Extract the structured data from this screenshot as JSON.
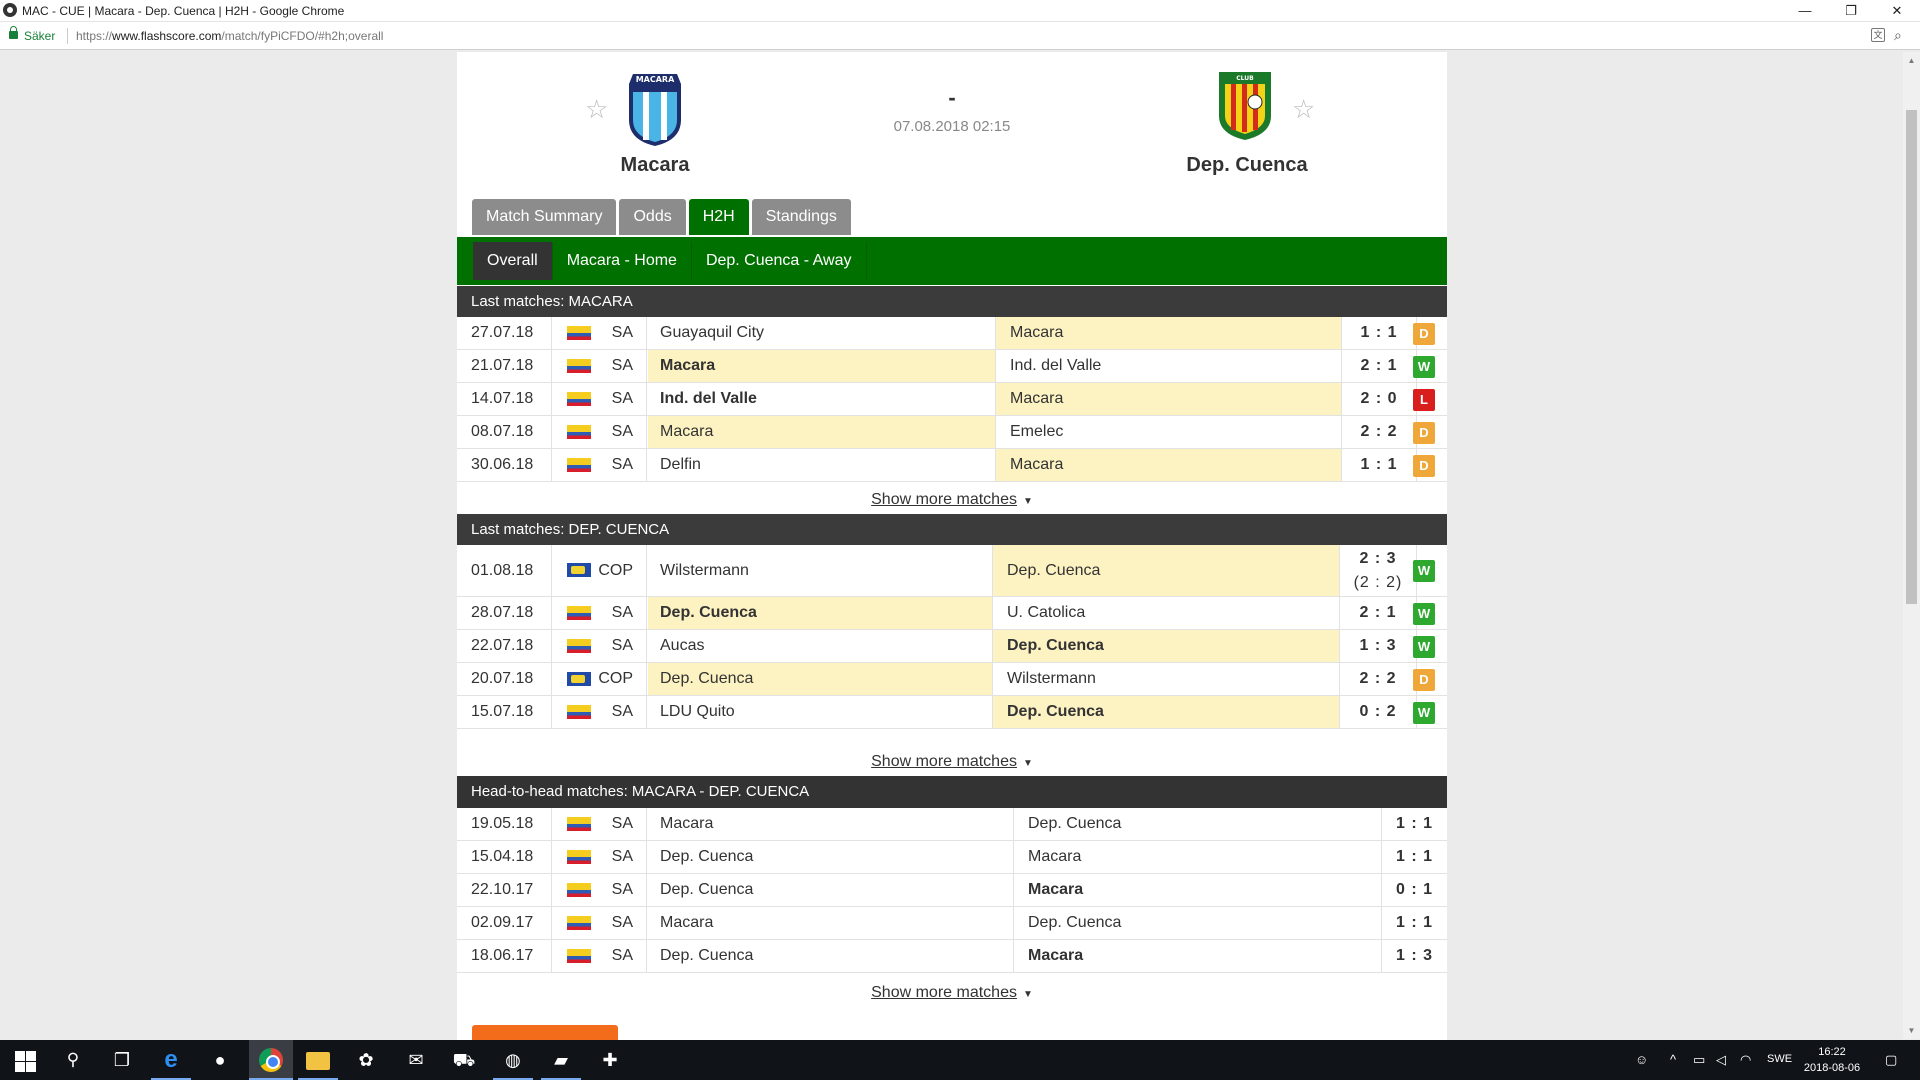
{
  "window": {
    "title": "MAC - CUE | Macara - Dep. Cuenca | H2H - Google Chrome",
    "minimize": "—",
    "maximize": "❐",
    "close": "✕"
  },
  "addressbar": {
    "secure_label": "Säker",
    "url_prefix": "https://",
    "url_host": "www.flashscore.com",
    "url_path": "/match/fyPiCFDO/#h2h;overall"
  },
  "match": {
    "home_team": "Macara",
    "away_team": "Dep. Cuenca",
    "score": "-",
    "datetime": "07.08.2018 02:15",
    "home_logo_text": "MACARA",
    "away_logo_text": "CLUB"
  },
  "tabs": [
    "Match Summary",
    "Odds",
    "H2H",
    "Standings"
  ],
  "active_tab": "H2H",
  "subtabs": [
    "Overall",
    "Macara - Home",
    "Dep. Cuenca - Away"
  ],
  "active_subtab": "Overall",
  "sections": {
    "last_home": {
      "title": "Last matches: MACARA",
      "rows": [
        {
          "date": "27.07.18",
          "comp": "SA",
          "flag": "ec",
          "home": "Guayaquil City",
          "away": "Macara",
          "score": "1 : 1",
          "result": "D",
          "hl": "away",
          "bold": ""
        },
        {
          "date": "21.07.18",
          "comp": "SA",
          "flag": "ec",
          "home": "Macara",
          "away": "Ind. del Valle",
          "score": "2 : 1",
          "result": "W",
          "hl": "home",
          "bold": "home"
        },
        {
          "date": "14.07.18",
          "comp": "SA",
          "flag": "ec",
          "home": "Ind. del Valle",
          "away": "Macara",
          "score": "2 : 0",
          "result": "L",
          "hl": "away",
          "bold": "home"
        },
        {
          "date": "08.07.18",
          "comp": "SA",
          "flag": "ec",
          "home": "Macara",
          "away": "Emelec",
          "score": "2 : 2",
          "result": "D",
          "hl": "home",
          "bold": ""
        },
        {
          "date": "30.06.18",
          "comp": "SA",
          "flag": "ec",
          "home": "Delfin",
          "away": "Macara",
          "score": "1 : 1",
          "result": "D",
          "hl": "away",
          "bold": ""
        }
      ]
    },
    "last_away": {
      "title": "Last matches: DEP. CUENCA",
      "rows": [
        {
          "date": "01.08.18",
          "comp": "COP",
          "flag": "sa",
          "home": "Wilstermann",
          "away": "Dep. Cuenca",
          "score": "2 : 3",
          "score2": "(2 : 2)",
          "result": "W",
          "hl": "away",
          "bold": ""
        },
        {
          "date": "28.07.18",
          "comp": "SA",
          "flag": "ec",
          "home": "Dep. Cuenca",
          "away": "U. Catolica",
          "score": "2 : 1",
          "result": "W",
          "hl": "home",
          "bold": "home"
        },
        {
          "date": "22.07.18",
          "comp": "SA",
          "flag": "ec",
          "home": "Aucas",
          "away": "Dep. Cuenca",
          "score": "1 : 3",
          "result": "W",
          "hl": "away",
          "bold": "away"
        },
        {
          "date": "20.07.18",
          "comp": "COP",
          "flag": "sa",
          "home": "Dep. Cuenca",
          "away": "Wilstermann",
          "score": "2 : 2",
          "result": "D",
          "hl": "home",
          "bold": ""
        },
        {
          "date": "15.07.18",
          "comp": "SA",
          "flag": "ec",
          "home": "LDU Quito",
          "away": "Dep. Cuenca",
          "score": "0 : 2",
          "result": "W",
          "hl": "away",
          "bold": "away"
        }
      ]
    },
    "h2h": {
      "title": "Head-to-head matches: MACARA - DEP. CUENCA",
      "rows": [
        {
          "date": "19.05.18",
          "comp": "SA",
          "flag": "ec",
          "home": "Macara",
          "away": "Dep. Cuenca",
          "score": "1 : 1",
          "bold": ""
        },
        {
          "date": "15.04.18",
          "comp": "SA",
          "flag": "ec",
          "home": "Dep. Cuenca",
          "away": "Macara",
          "score": "1 : 1",
          "bold": ""
        },
        {
          "date": "22.10.17",
          "comp": "SA",
          "flag": "ec",
          "home": "Dep. Cuenca",
          "away": "Macara",
          "score": "0 : 1",
          "bold": "away"
        },
        {
          "date": "02.09.17",
          "comp": "SA",
          "flag": "ec",
          "home": "Macara",
          "away": "Dep. Cuenca",
          "score": "1 : 1",
          "bold": ""
        },
        {
          "date": "18.06.17",
          "comp": "SA",
          "flag": "ec",
          "home": "Dep. Cuenca",
          "away": "Macara",
          "score": "1 : 3",
          "bold": "away"
        }
      ]
    }
  },
  "show_more_label": "Show more matches",
  "taskbar": {
    "language": "SWE",
    "time": "16:22",
    "date": "2018-08-06"
  },
  "colors": {
    "green": "#007100",
    "highlight": "#fdf2c2",
    "win": "#2ea82e",
    "draw": "#f0a73a",
    "loss": "#d91e1e"
  }
}
